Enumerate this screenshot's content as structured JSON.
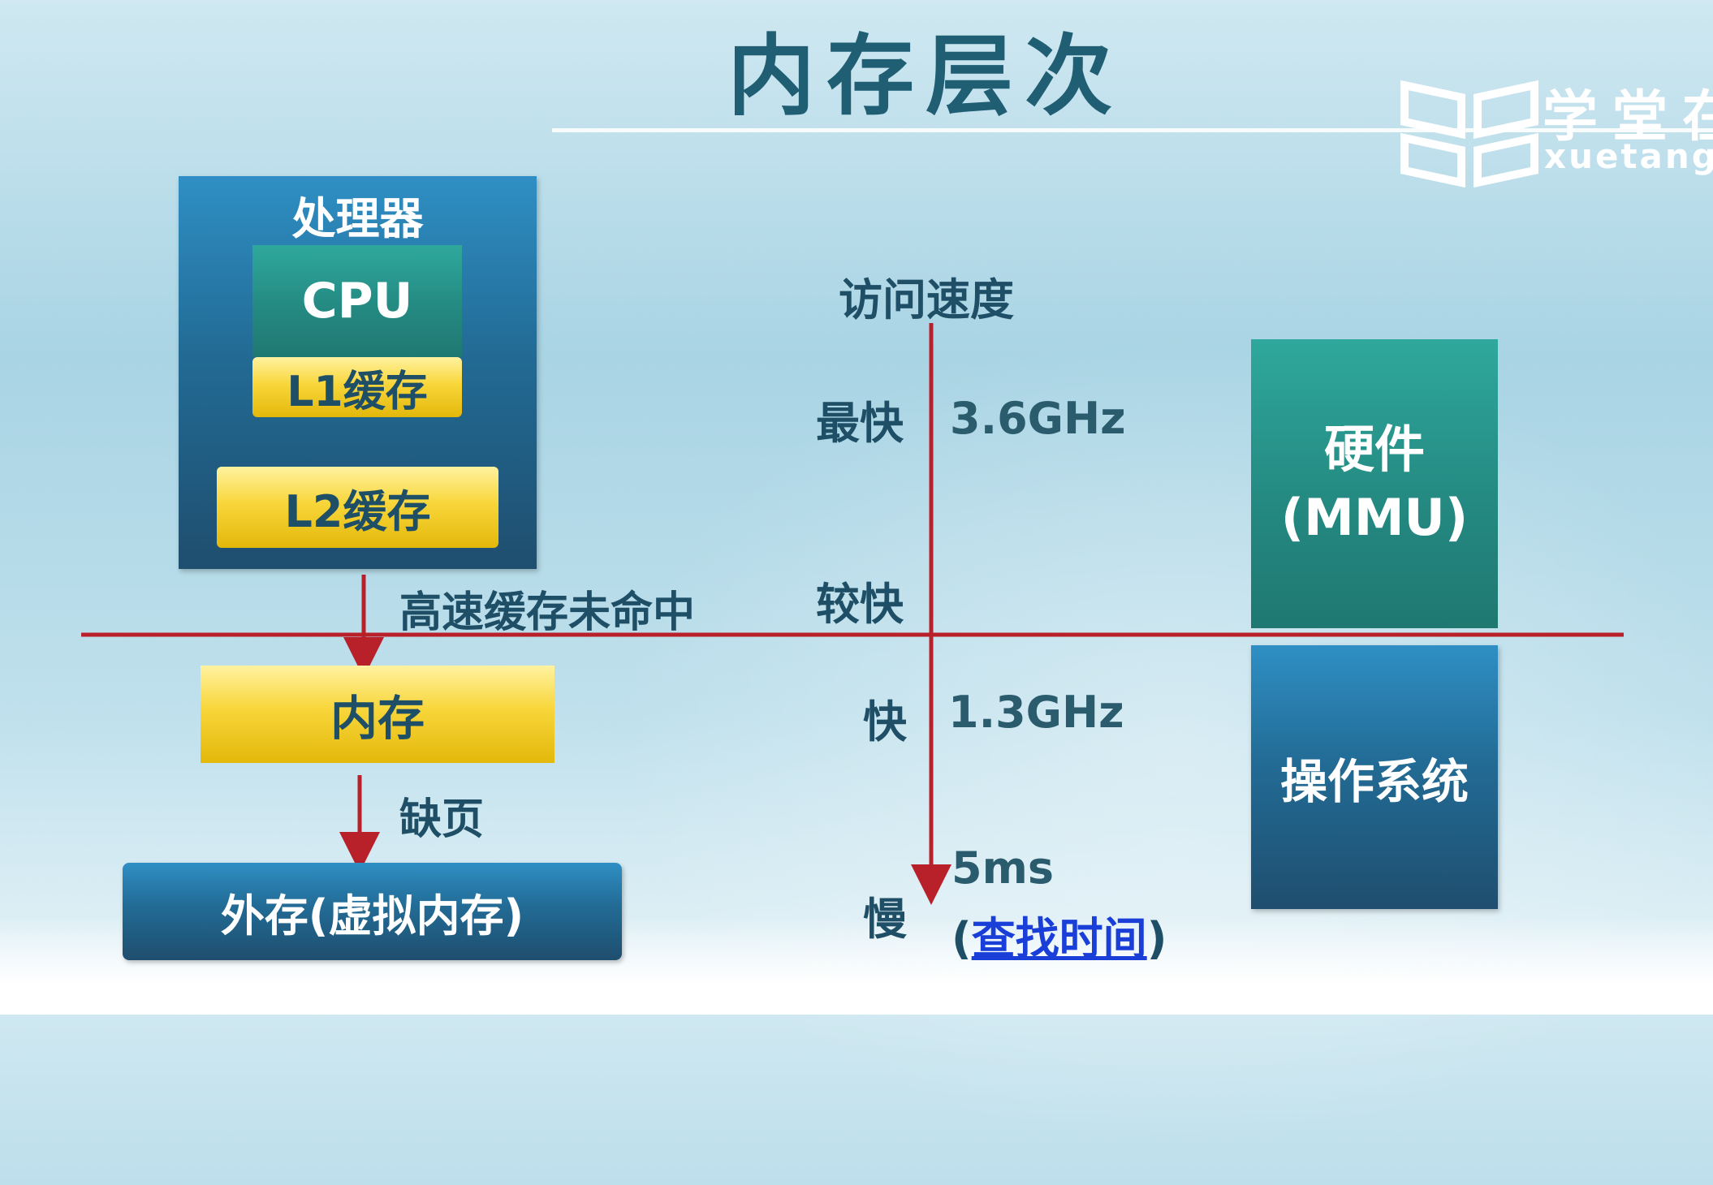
{
  "title": "内存层次",
  "logo": {
    "name": "学堂在",
    "sub": "xuetangx"
  },
  "hierarchy": {
    "processor": "处理器",
    "cpu": "CPU",
    "l1": "L1缓存",
    "l2": "L2缓存",
    "cache_miss": "高速缓存未命中",
    "memory": "内存",
    "page_fault": "缺页",
    "disk": "外存(虚拟内存)"
  },
  "speed": {
    "title": "访问速度",
    "levels": [
      {
        "label": "最快",
        "value": "3.6GHz"
      },
      {
        "label": "较快",
        "value": ""
      },
      {
        "label": "快",
        "value": "1.3GHz"
      },
      {
        "label": "慢",
        "value": "5ms"
      }
    ],
    "lookup_open": "(",
    "lookup": "查找时间",
    "lookup_close": ")"
  },
  "management": {
    "hardware_line1": "硬件",
    "hardware_line2": "(MMU)",
    "os": "操作系统"
  },
  "colors": {
    "axis_red": "#b8202a",
    "text_dark": "#1f4f66",
    "title": "#1f5e73",
    "link": "#1a3fd8"
  }
}
